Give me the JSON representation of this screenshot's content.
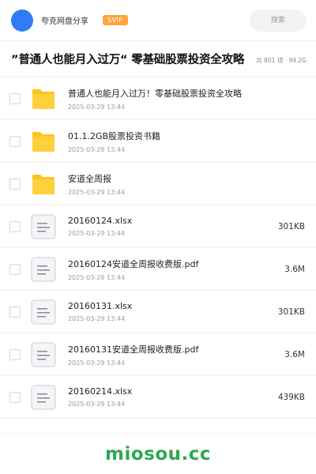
{
  "header": {
    "app_name": "夸克网盘分享",
    "badge": "SVIP",
    "search_placeholder": "搜索"
  },
  "share": {
    "title": "”普通人也能月入过万“ 零基础股票投资全攻略",
    "meta": "共 801 项 · 94.2G"
  },
  "files": [
    {
      "name": "普通人也能月入过万！零基础股票投资全攻略",
      "date": "2025-03-29 13:44",
      "size": "",
      "type": "folder"
    },
    {
      "name": "01.1.2GB股票投资书籍",
      "date": "2025-03-29 13:44",
      "size": "",
      "type": "folder"
    },
    {
      "name": "安道全周报",
      "date": "2025-03-29 13:44",
      "size": "",
      "type": "folder"
    },
    {
      "name": "20160124.xlsx",
      "date": "2025-03-29 13:44",
      "size": "301KB",
      "type": "file"
    },
    {
      "name": "20160124安道全周报收费版.pdf",
      "date": "2025-03-29 13:44",
      "size": "3.6M",
      "type": "file"
    },
    {
      "name": "20160131.xlsx",
      "date": "2025-03-29 13:44",
      "size": "301KB",
      "type": "file"
    },
    {
      "name": "20160131安道全周报收费版.pdf",
      "date": "2025-03-29 13:44",
      "size": "3.6M",
      "type": "file"
    },
    {
      "name": "20160214.xlsx",
      "date": "2025-03-29 13:44",
      "size": "439KB",
      "type": "file"
    }
  ],
  "watermark": "miosou.cc",
  "colors": {
    "avatar": "#2f7cf6",
    "badge": "#ffa53a",
    "folder": "#ffc31f",
    "watermark": "#2fa84f"
  },
  "icons": {
    "folder": "folder-icon",
    "file": "document-icon",
    "checkbox": "checkbox-icon"
  }
}
